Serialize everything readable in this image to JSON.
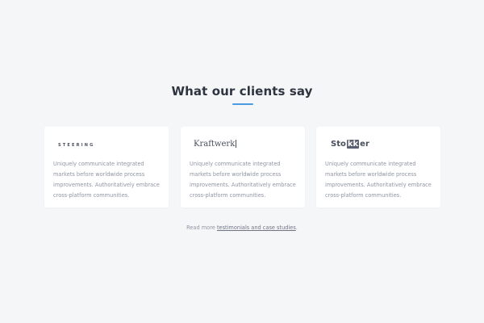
{
  "section": {
    "title": "What our clients say",
    "accent_color": "#4a9be0"
  },
  "testimonials": [
    {
      "logo_text": "STEERING",
      "text": "Uniquely communicate integrated markets before worldwide process improvements. Authoritatively embrace cross-platform communities."
    },
    {
      "logo_text": "Kraftwerk",
      "text": "Uniquely communicate integrated markets before worldwide process improvements. Authoritatively embrace cross-platform communities."
    },
    {
      "logo_text_start": "Sto",
      "logo_text_highlight": "kk",
      "logo_text_end": "er",
      "text": "Uniquely communicate integrated markets before worldwide process improvements. Authoritatively embrace cross-platform communities."
    }
  ],
  "footer": {
    "prefix": "Read more ",
    "link_text": "testimonials and case studies",
    "suffix": "."
  }
}
